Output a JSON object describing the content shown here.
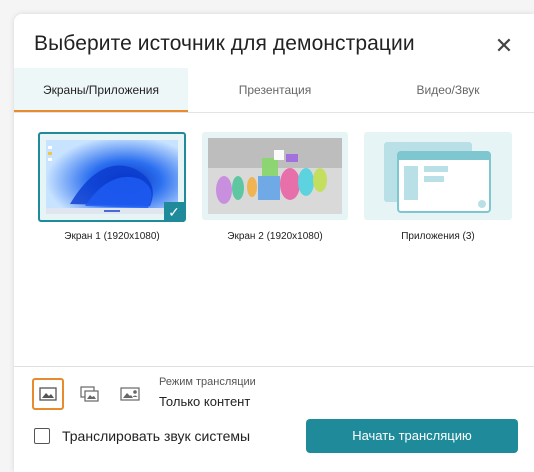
{
  "dialog": {
    "title": "Выберите источник для демонстрации",
    "close_icon": "close-icon"
  },
  "tabs": [
    {
      "label": "Экраны/Приложения",
      "active": true
    },
    {
      "label": "Презентация",
      "active": false
    },
    {
      "label": "Видео/Звук",
      "active": false
    }
  ],
  "sources": [
    {
      "caption": "Экран 1 (1920x1080)",
      "selected": true
    },
    {
      "caption": "Экран 2 (1920x1080)",
      "selected": false
    },
    {
      "caption": "Приложения (3)",
      "selected": false
    }
  ],
  "broadcast": {
    "mode_label": "Режим трансляции",
    "mode_value": "Только контент",
    "system_audio_label": "Транслировать звук системы",
    "start_label": "Начать трансляцию"
  },
  "colors": {
    "accent": "#1f8a9a",
    "tab_indicator": "#e88a2e",
    "thumb_bg": "#e6f4f6"
  }
}
